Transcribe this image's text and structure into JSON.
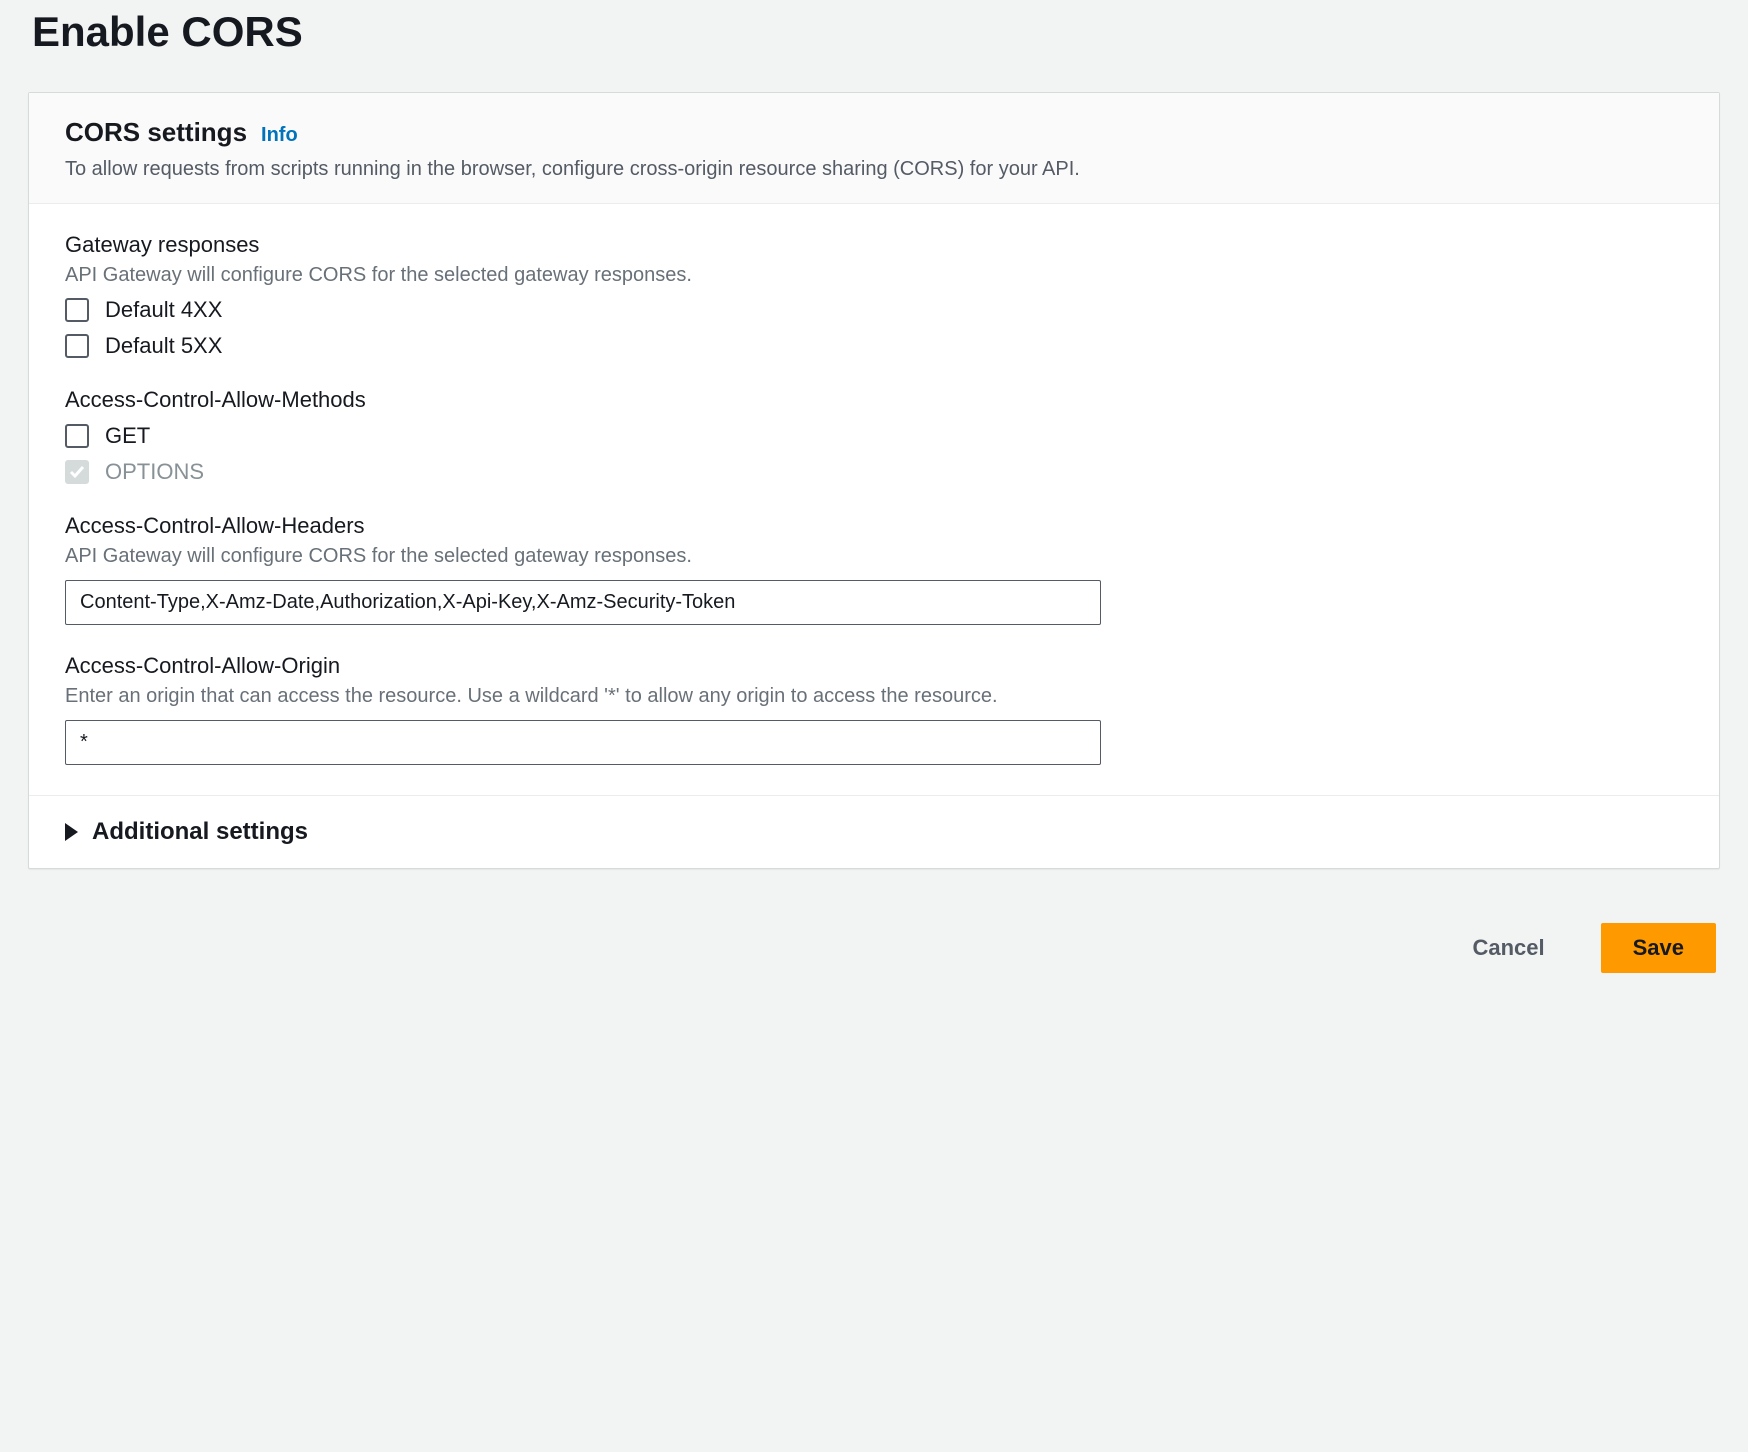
{
  "page": {
    "title": "Enable CORS"
  },
  "cors_panel": {
    "title": "CORS settings",
    "info_label": "Info",
    "description": "To allow requests from scripts running in the browser, configure cross-origin resource sharing (CORS) for your API."
  },
  "gateway": {
    "label": "Gateway responses",
    "hint": "API Gateway will configure CORS for the selected gateway responses.",
    "items": [
      {
        "label": "Default 4XX",
        "checked": false,
        "disabled": false
      },
      {
        "label": "Default 5XX",
        "checked": false,
        "disabled": false
      }
    ]
  },
  "methods": {
    "label": "Access-Control-Allow-Methods",
    "items": [
      {
        "label": "GET",
        "checked": false,
        "disabled": false
      },
      {
        "label": "OPTIONS",
        "checked": true,
        "disabled": true
      }
    ]
  },
  "headers": {
    "label": "Access-Control-Allow-Headers",
    "hint": "API Gateway will configure CORS for the selected gateway responses.",
    "value": "Content-Type,X-Amz-Date,Authorization,X-Api-Key,X-Amz-Security-Token"
  },
  "origin": {
    "label": "Access-Control-Allow-Origin",
    "hint": "Enter an origin that can access the resource. Use a wildcard '*' to allow any origin to access the resource.",
    "value": "*"
  },
  "additional": {
    "label": "Additional settings"
  },
  "actions": {
    "cancel": "Cancel",
    "save": "Save"
  }
}
